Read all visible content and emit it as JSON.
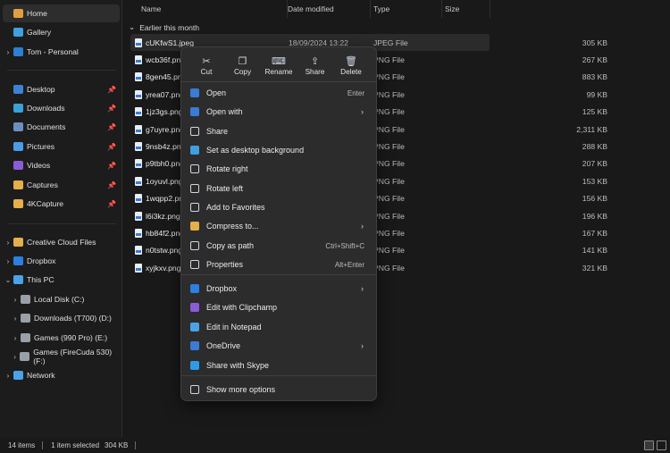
{
  "sidebar": {
    "items": [
      {
        "label": "Home",
        "color": "#e0a040",
        "chev": "",
        "pin": false,
        "active": true
      },
      {
        "label": "Gallery",
        "color": "#3fa0e0",
        "chev": "",
        "pin": false
      },
      {
        "label": "Tom - Personal",
        "color": "#2d7fd3",
        "chev": "›",
        "pin": false
      },
      {
        "label": "Desktop",
        "color": "#3b82d6",
        "chev": "",
        "pin": true
      },
      {
        "label": "Downloads",
        "color": "#3aa0d8",
        "chev": "",
        "pin": true
      },
      {
        "label": "Documents",
        "color": "#6c8fbf",
        "chev": "",
        "pin": true
      },
      {
        "label": "Pictures",
        "color": "#4b9be6",
        "chev": "",
        "pin": true
      },
      {
        "label": "Videos",
        "color": "#8a5cd6",
        "chev": "",
        "pin": true
      },
      {
        "label": "Captures",
        "color": "#e4b04a",
        "chev": "",
        "pin": true
      },
      {
        "label": "4KCapture",
        "color": "#e4b04a",
        "chev": "",
        "pin": true
      },
      {
        "label": "Creative Cloud Files",
        "color": "#e4b04a",
        "chev": "›",
        "pin": false
      },
      {
        "label": "Dropbox",
        "color": "#2d7fe0",
        "chev": "›",
        "pin": false
      },
      {
        "label": "This PC",
        "color": "#4aa3e8",
        "chev": "⌄",
        "pin": false
      },
      {
        "label": "Local Disk (C:)",
        "color": "#9aa0a8",
        "chev": "›",
        "pin": false,
        "indent": true
      },
      {
        "label": "Downloads (T700) (D:)",
        "color": "#9aa0a8",
        "chev": "›",
        "pin": false,
        "indent": true
      },
      {
        "label": "Games (990 Pro) (E:)",
        "color": "#9aa0a8",
        "chev": "›",
        "pin": false,
        "indent": true
      },
      {
        "label": "Games (FireCuda 530) (F:)",
        "color": "#9aa0a8",
        "chev": "›",
        "pin": false,
        "indent": true
      },
      {
        "label": "Network",
        "color": "#4aa3e8",
        "chev": "›",
        "pin": false
      }
    ]
  },
  "columns": {
    "name": "Name",
    "date": "Date modified",
    "type": "Type",
    "size": "Size"
  },
  "group_label": "Earlier this month",
  "files": [
    {
      "name": "cUKfwS1.jpeg",
      "date": "18/09/2024 13:22",
      "type": "JPEG File",
      "size": "305 KB",
      "selected": true
    },
    {
      "name": "wcb36f.png",
      "date": "",
      "type": "PNG File",
      "size": "267 KB"
    },
    {
      "name": "8gen45.png",
      "date": "",
      "type": "PNG File",
      "size": "883 KB"
    },
    {
      "name": "yrea07.png",
      "date": "",
      "type": "PNG File",
      "size": "99 KB"
    },
    {
      "name": "1jz3gs.png",
      "date": "",
      "type": "PNG File",
      "size": "125 KB"
    },
    {
      "name": "g7uyre.png",
      "date": "",
      "type": "PNG File",
      "size": "2,311 KB"
    },
    {
      "name": "9nsb4z.png",
      "date": "",
      "type": "PNG File",
      "size": "288 KB"
    },
    {
      "name": "p9tbh0.png",
      "date": "",
      "type": "PNG File",
      "size": "207 KB"
    },
    {
      "name": "1oyuvl.png",
      "date": "",
      "type": "PNG File",
      "size": "153 KB"
    },
    {
      "name": "1wqpp2.png",
      "date": "",
      "type": "PNG File",
      "size": "156 KB"
    },
    {
      "name": "l6i3kz.png",
      "date": "",
      "type": "PNG File",
      "size": "196 KB"
    },
    {
      "name": "hb84f2.png",
      "date": "",
      "type": "PNG File",
      "size": "167 KB"
    },
    {
      "name": "n0tstw.png",
      "date": "",
      "type": "PNG File",
      "size": "141 KB"
    },
    {
      "name": "xyjkxv.png",
      "date": "",
      "type": "PNG File",
      "size": "321 KB"
    }
  ],
  "status": {
    "count": "14 items",
    "selected": "1 item selected",
    "size": "304 KB"
  },
  "menu": {
    "quick": [
      {
        "label": "Cut",
        "icon": "scissors-icon",
        "glyph": "✂"
      },
      {
        "label": "Copy",
        "icon": "copy-icon",
        "glyph": "❐"
      },
      {
        "label": "Rename",
        "icon": "rename-icon",
        "glyph": "⌨"
      },
      {
        "label": "Share",
        "icon": "share-icon",
        "glyph": "⇪"
      },
      {
        "label": "Delete",
        "icon": "trash-icon",
        "glyph": "🗑"
      }
    ],
    "items": [
      {
        "label": "Open",
        "shortcut": "Enter",
        "icon": "open-icon",
        "color": "#3a7bd5"
      },
      {
        "label": "Open with",
        "arrow": true,
        "icon": "open-with-icon",
        "color": "#3a7bd5"
      },
      {
        "label": "Share",
        "icon": "share-icon",
        "color": ""
      },
      {
        "label": "Set as desktop background",
        "icon": "desktop-background-icon",
        "color": "#3fa0e0"
      },
      {
        "label": "Rotate right",
        "icon": "rotate-right-icon",
        "color": ""
      },
      {
        "label": "Rotate left",
        "icon": "rotate-left-icon",
        "color": ""
      },
      {
        "label": "Add to Favorites",
        "icon": "star-icon",
        "color": ""
      },
      {
        "label": "Compress to...",
        "arrow": true,
        "icon": "zip-icon",
        "color": "#e4b04a"
      },
      {
        "label": "Copy as path",
        "shortcut": "Ctrl+Shift+C",
        "icon": "path-icon",
        "color": ""
      },
      {
        "label": "Properties",
        "shortcut": "Alt+Enter",
        "icon": "wrench-icon",
        "color": ""
      },
      {
        "label": "Dropbox",
        "arrow": true,
        "icon": "dropbox-icon",
        "color": "#2d7fe0"
      },
      {
        "label": "Edit with Clipchamp",
        "icon": "clipchamp-icon",
        "color": "#8a5cd6"
      },
      {
        "label": "Edit in Notepad",
        "icon": "notepad-icon",
        "color": "#4aa3e8"
      },
      {
        "label": "OneDrive",
        "arrow": true,
        "icon": "onedrive-icon",
        "color": "#3a7bd5"
      },
      {
        "label": "Share with Skype",
        "icon": "skype-icon",
        "color": "#2d9be6"
      },
      {
        "label": "Show more options",
        "icon": "more-options-icon",
        "color": ""
      }
    ]
  }
}
